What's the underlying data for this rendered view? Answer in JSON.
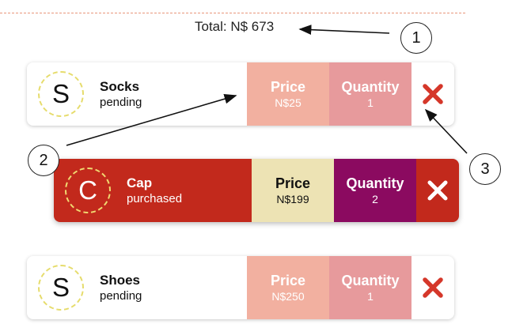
{
  "total": {
    "text": "Total: N$ 673"
  },
  "items": [
    {
      "initial": "S",
      "name": "Socks",
      "status": "pending",
      "price_label": "Price",
      "price": "N$25",
      "qty_label": "Quantity",
      "qty": "1"
    },
    {
      "initial": "C",
      "name": "Cap",
      "status": "purchased",
      "price_label": "Price",
      "price": "N$199",
      "qty_label": "Quantity",
      "qty": "2"
    },
    {
      "initial": "S",
      "name": "Shoes",
      "status": "pending",
      "price_label": "Price",
      "price": "N$250",
      "qty_label": "Quantity",
      "qty": "1"
    }
  ],
  "callouts": [
    "1",
    "2",
    "3"
  ],
  "icons": {
    "remove": "close-icon"
  },
  "colors": {
    "pending_price": "#f2b0a0",
    "pending_quantity": "#e79a9c",
    "pending_remove": "#d5372a",
    "active_background": "#c2291c",
    "active_price": "#ede3b4",
    "active_quantity": "#8b0a60"
  }
}
